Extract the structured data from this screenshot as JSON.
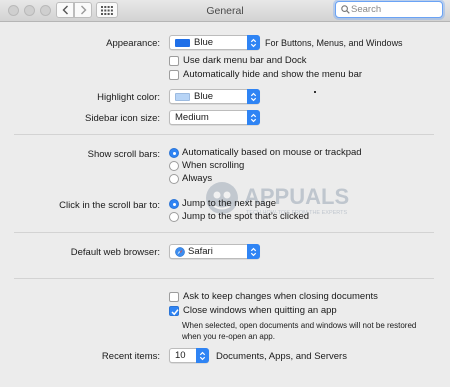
{
  "window": {
    "title": "General",
    "search_placeholder": "Search"
  },
  "appearance": {
    "label": "Appearance:",
    "value": "Blue",
    "swatch_color": "#1f6fe8",
    "side_text": "For Buttons, Menus, and Windows",
    "options": [
      {
        "label": "Use dark menu bar and Dock",
        "checked": false
      },
      {
        "label": "Automatically hide and show the menu bar",
        "checked": false
      }
    ]
  },
  "highlight": {
    "label": "Highlight color:",
    "value": "Blue",
    "swatch_color": "#b7d4f6"
  },
  "sidebar_icon_size": {
    "label": "Sidebar icon size:",
    "value": "Medium"
  },
  "scroll_bars": {
    "label": "Show scroll bars:",
    "options": [
      {
        "label": "Automatically based on mouse or trackpad",
        "selected": true
      },
      {
        "label": "When scrolling",
        "selected": false
      },
      {
        "label": "Always",
        "selected": false
      }
    ]
  },
  "click_scroll": {
    "label": "Click in the scroll bar to:",
    "options": [
      {
        "label": "Jump to the next page",
        "selected": true
      },
      {
        "label": "Jump to the spot that’s clicked",
        "selected": false
      }
    ]
  },
  "browser": {
    "label": "Default web browser:",
    "value": "Safari",
    "icon": "safari-icon"
  },
  "documents": {
    "options": [
      {
        "label": "Ask to keep changes when closing documents",
        "checked": false
      },
      {
        "label": "Close windows when quitting an app",
        "checked": true
      }
    ],
    "note_line1": "When selected, open documents and windows will not be restored",
    "note_line2": "when you re-open an app."
  },
  "recent": {
    "label": "Recent items:",
    "value": "10",
    "side_text": "Documents, Apps, and Servers"
  },
  "watermark": {
    "text": "APPUALS",
    "sub": "TECH HOW-TO'S FROM THE EXPERTS"
  },
  "colors": {
    "accent": "#2f84f4",
    "background": "#ececec"
  }
}
